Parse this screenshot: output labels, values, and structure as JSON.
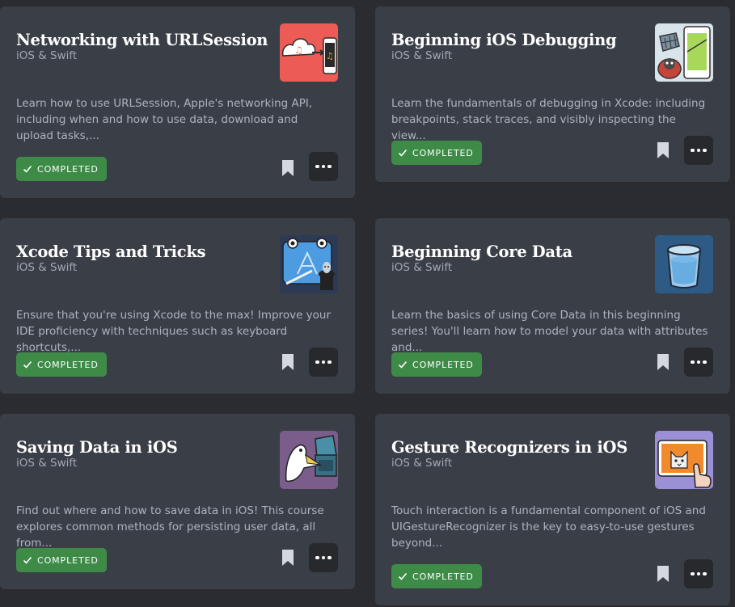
{
  "cards": [
    {
      "title": "Networking with URLSession",
      "category": "iOS & Swift",
      "description": "Learn how to use URLSession, Apple's networking API, including when and how to use data, download and upload tasks,...",
      "status": "COMPLETED",
      "thumbnail_icon": "cloud-music-icon"
    },
    {
      "title": "Beginning iOS Debugging",
      "category": "iOS & Swift",
      "description": "Learn the fundamentals of debugging in Xcode: including breakpoints, stack traces, and visibly inspecting the view...",
      "status": "COMPLETED",
      "thumbnail_icon": "bug-phone-icon"
    },
    {
      "title": "Xcode Tips and Tricks",
      "category": "iOS & Swift",
      "description": "Ensure that you're using Xcode to the max! Improve your IDE proficiency with techniques such as keyboard shortcuts,...",
      "status": "COMPLETED",
      "thumbnail_icon": "xcode-magic-hat-icon"
    },
    {
      "title": "Beginning Core Data",
      "category": "iOS & Swift",
      "description": "Learn the basics of using Core Data in this beginning series! You'll learn how to model your data with attributes and...",
      "status": "COMPLETED",
      "thumbnail_icon": "database-bucket-icon"
    },
    {
      "title": "Saving Data in iOS",
      "category": "iOS & Swift",
      "description": "Find out where and how to save data in iOS! This course explores common methods for persisting user data, all from...",
      "status": "COMPLETED",
      "thumbnail_icon": "pelican-briefcase-icon"
    },
    {
      "title": "Gesture Recognizers in iOS",
      "category": "iOS & Swift",
      "description": "Touch interaction is a fundamental component of iOS and UIGestureRecognizer is the key to easy-to-use gestures beyond...",
      "status": "COMPLETED",
      "thumbnail_icon": "cat-tablet-icon"
    }
  ],
  "colors": {
    "background": "#2a2c31",
    "card": "#3a3e47",
    "completed_badge": "#3e8b48",
    "more_button": "#27292d"
  }
}
